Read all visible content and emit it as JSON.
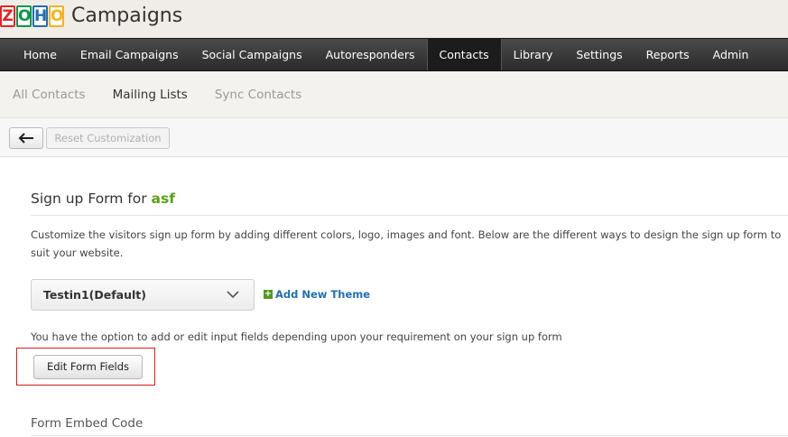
{
  "brand": {
    "logo_letters": [
      "Z",
      "O",
      "H",
      "O"
    ],
    "product": "Campaigns"
  },
  "topnav": {
    "items": [
      {
        "label": "Home",
        "active": false
      },
      {
        "label": "Email Campaigns",
        "active": false
      },
      {
        "label": "Social Campaigns",
        "active": false
      },
      {
        "label": "Autoresponders",
        "active": false
      },
      {
        "label": "Contacts",
        "active": true
      },
      {
        "label": "Library",
        "active": false
      },
      {
        "label": "Settings",
        "active": false
      },
      {
        "label": "Reports",
        "active": false
      },
      {
        "label": "Admin",
        "active": false
      }
    ]
  },
  "subnav": {
    "items": [
      {
        "label": "All Contacts",
        "active": false
      },
      {
        "label": "Mailing Lists",
        "active": true
      },
      {
        "label": "Sync Contacts",
        "active": false
      }
    ]
  },
  "toolbar": {
    "back_icon": "arrow-left-icon",
    "reset_label": "Reset Customization"
  },
  "page": {
    "title_prefix": "Sign up Form for",
    "list_name": "asf",
    "description": "Customize the visitors sign up form by adding different colors, logo, images and font. Below are the different ways to design the sign up form to suit your website.",
    "theme_selected": "Testin1(Default)",
    "add_theme_label": "Add New Theme",
    "option_text": "You have the option to add or edit input fields depending upon your requirement on your sign up form",
    "edit_fields_label": "Edit Form Fields",
    "embed_title": "Form Embed Code"
  },
  "colors": {
    "nav_bg": "#333333",
    "list_name": "#58a212",
    "link": "#1f6fb3",
    "highlight": "#d71d1d"
  }
}
